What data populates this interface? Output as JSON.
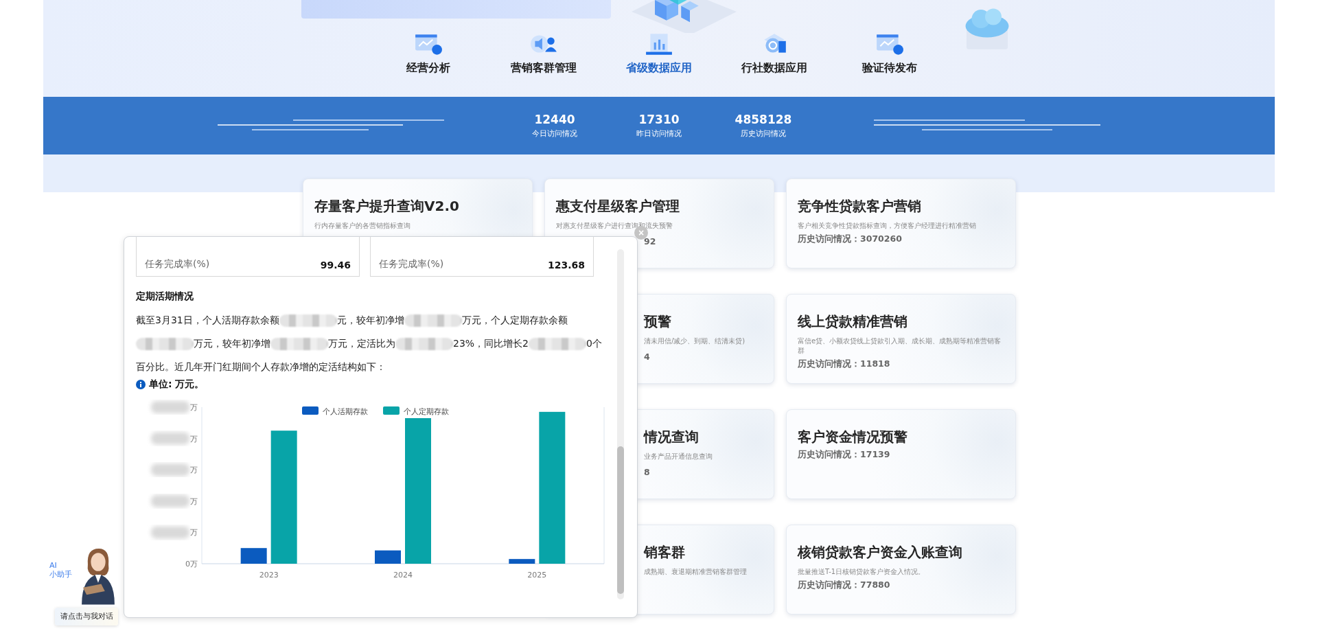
{
  "nav": [
    {
      "label": "经营分析",
      "kind": "trend",
      "selected": false
    },
    {
      "label": "营销客群管理",
      "kind": "audience",
      "selected": false
    },
    {
      "label": "省级数据应用",
      "kind": "bars",
      "selected": true
    },
    {
      "label": "行社数据应用",
      "kind": "target",
      "selected": false
    },
    {
      "label": "验证待发布",
      "kind": "trend",
      "selected": false
    }
  ],
  "stats": [
    {
      "value": "12440",
      "label": "今日访问情况"
    },
    {
      "value": "17310",
      "label": "昨日访问情况"
    },
    {
      "value": "4858128",
      "label": "历史访问情况"
    }
  ],
  "card_rows": [
    [
      {
        "title": "存量客户提升查询V2.0",
        "description": "行内存量客户的各营销指标查询"
      },
      {
        "title": "惠支付星级客户管理",
        "description": "对惠支付星级客户进行查询和流失预警",
        "history": "92",
        "kind": "tail"
      },
      {
        "title": "竞争性贷款客户营销",
        "description": "客户相关竞争性贷款指标查询，方便客户经理进行精准营销",
        "history": "历史访问情况：3070260"
      }
    ],
    [
      {
        "title": "预警",
        "description": "清未用信/减少、到期、结清未贷)",
        "history": "4",
        "kind": "clipped"
      },
      {
        "title": "线上贷款精准营销",
        "description": "富信e贷、小额农贷线上贷款引入期、成长期、成熟期等精准营销客群",
        "history": "历史访问情况：11818"
      }
    ],
    [
      {
        "title": "情况查询",
        "description": "业务产品开通信息查询",
        "history": "8",
        "kind": "clipped"
      },
      {
        "title": "客户资金情况预警",
        "history": "历史访问情况：17139"
      }
    ],
    [
      {
        "title": "销客群",
        "description": "成熟期、衰退期精准营销客群管理",
        "kind": "clipped"
      },
      {
        "title": "核销贷款客户资金入账查询",
        "description": "批量推送T-1日核销贷款客户资金入情况。",
        "history": "历史访问情况：77880"
      }
    ]
  ],
  "popup": {
    "close": "×",
    "metrics": [
      {
        "label": "任务完成率(%)",
        "value": "99.46"
      },
      {
        "label": "任务完成率(%)",
        "value": "123.68"
      }
    ],
    "section_title": "定期活期情况",
    "paragraph": [
      {
        "kind": "text",
        "text": "截至3月31日，个人活期存款余额"
      },
      {
        "kind": "redacted"
      },
      {
        "kind": "text",
        "text": "元，较年初净增"
      },
      {
        "kind": "redacted"
      },
      {
        "kind": "text",
        "text": "万元，个人定期存款余额"
      },
      {
        "kind": "redacted"
      },
      {
        "kind": "text",
        "text": "万元，较年初净增"
      },
      {
        "kind": "redacted"
      },
      {
        "kind": "text",
        "text": "万元，定活比为"
      },
      {
        "kind": "redacted"
      },
      {
        "kind": "text",
        "text": "23%，同比增长2"
      },
      {
        "kind": "redacted"
      },
      {
        "kind": "text",
        "text": "0个百分比。近几年开门红期间个人存款净增的定活结构如下："
      }
    ],
    "unit_note": "单位: 万元。",
    "chart": {
      "legend": [
        {
          "name": "个人活期存款",
          "color": "#0b5bbf"
        },
        {
          "name": "个人定期存款",
          "color": "#08a4a8"
        }
      ],
      "categories": [
        "2023",
        "2024",
        "2025"
      ],
      "y_labels": [
        {
          "text": "万",
          "blurred": true
        },
        {
          "text": "万",
          "blurred": true
        },
        {
          "text": "万",
          "blurred": true
        },
        {
          "text": "万",
          "blurred": true
        },
        {
          "text": "万",
          "blurred": true
        },
        {
          "text": "0万",
          "blurred": false
        }
      ]
    }
  },
  "assistant": {
    "tag_lines": [
      "AI",
      "小助手"
    ],
    "button": "请点击与我对话"
  }
}
